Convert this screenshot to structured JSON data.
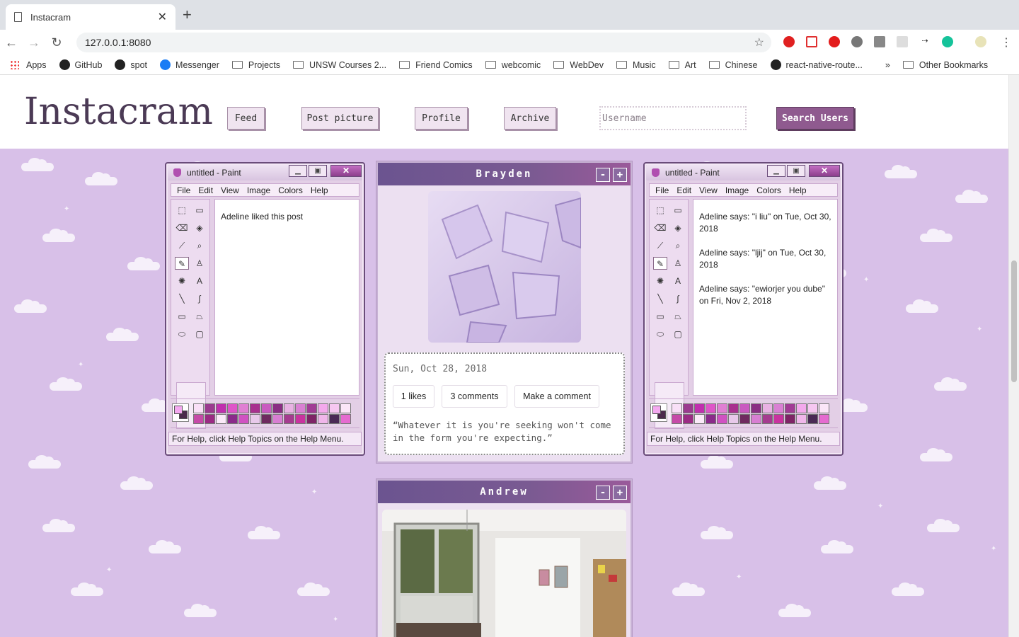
{
  "browser": {
    "tab_title": "Instacram",
    "new_tab": "+",
    "close_tab": "✕",
    "url": "127.0.0.1:8080",
    "bookmarks": [
      {
        "label": "Apps",
        "icon": "apps-icon"
      },
      {
        "label": "GitHub",
        "icon": "github-icon"
      },
      {
        "label": "spot",
        "icon": "spotify-icon"
      },
      {
        "label": "Messenger",
        "icon": "messenger-icon"
      },
      {
        "label": "Projects",
        "icon": "folder-icon"
      },
      {
        "label": "UNSW Courses 2...",
        "icon": "folder-icon"
      },
      {
        "label": "Friend Comics",
        "icon": "folder-icon"
      },
      {
        "label": "webcomic",
        "icon": "folder-icon"
      },
      {
        "label": "WebDev",
        "icon": "folder-icon"
      },
      {
        "label": "Music",
        "icon": "folder-icon"
      },
      {
        "label": "Art",
        "icon": "folder-icon"
      },
      {
        "label": "Chinese",
        "icon": "folder-icon"
      },
      {
        "label": "react-native-route...",
        "icon": "github-icon"
      }
    ],
    "overflow": "»",
    "other_bookmarks": "Other Bookmarks"
  },
  "header": {
    "logo": "Instacram",
    "nav": [
      "Feed",
      "Post picture",
      "Profile",
      "Archive"
    ],
    "search_placeholder": "Username",
    "search_button": "Search Users"
  },
  "likes_window": {
    "title": "untitled - Paint",
    "menu": [
      "File",
      "Edit",
      "View",
      "Image",
      "Colors",
      "Help"
    ],
    "content": [
      "Adeline liked this post"
    ],
    "status": "For Help, click Help Topics on the Help Menu."
  },
  "comments_window": {
    "title": "untitled - Paint",
    "menu": [
      "File",
      "Edit",
      "View",
      "Image",
      "Colors",
      "Help"
    ],
    "content": [
      "Adeline says: \"i liu\" on Tue, Oct 30, 2018",
      "Adeline says: \"ljij\" on Tue, Oct 30, 2018",
      "Adeline says: \"ewiorjer you dube\" on Fri, Nov 2, 2018"
    ],
    "status": "For Help, click Help Topics on the Help Menu."
  },
  "posts": [
    {
      "author": "Brayden",
      "minimize": "-",
      "expand": "+",
      "date": "Sun, Oct 28, 2018",
      "likes": "1 likes",
      "comments": "3 comments",
      "make_comment": "Make a comment",
      "quote": "“Whatever it is you're seeking won't come in the form you're expecting.”"
    },
    {
      "author": "Andrew",
      "minimize": "-",
      "expand": "+"
    }
  ],
  "colors": {
    "accent": "#8f5a8f",
    "page_bg": "#d8c0e8",
    "post_header": "#6b5490",
    "palette": [
      "#f9e0f7",
      "#9b3a8f",
      "#c02fae",
      "#de55c8",
      "#e07fd3",
      "#a8308e",
      "#c95ac0",
      "#8a2e83",
      "#e8b2e3",
      "#d980d3",
      "#a13c95",
      "#f3a9ec",
      "#f6c7f1",
      "#fbe6f8",
      "#c64aa8",
      "#9b2b84",
      "#fbeaf9",
      "#8a2a8a",
      "#d052c2",
      "#e8c9ea",
      "#6e2a5f",
      "#d87fd2",
      "#a53b8f",
      "#c9339f",
      "#7e2466",
      "#f0b6ea",
      "#4a2a55",
      "#e56bd0",
      "#f7d6f2",
      "#b03aa5"
    ]
  }
}
